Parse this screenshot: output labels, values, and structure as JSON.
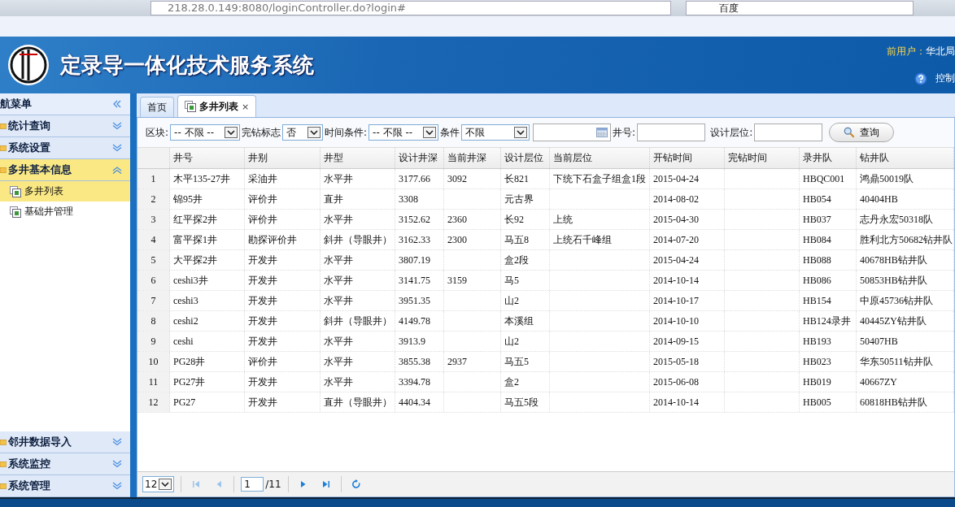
{
  "browser": {
    "url": "218.28.0.149:8080/loginController.do?login#",
    "search": "百度"
  },
  "header": {
    "title": "定录导一体化技术服务系统",
    "user_label": "前用户：",
    "user": "华北局",
    "control": "控制"
  },
  "nav": {
    "title": "航菜单",
    "sections": [
      {
        "label": "统计查询",
        "expanded": false
      },
      {
        "label": "系统设置",
        "expanded": false
      },
      {
        "label": "多井基本信息",
        "expanded": true,
        "children": [
          {
            "label": "多井列表",
            "selected": true
          },
          {
            "label": "基础井管理",
            "selected": false
          }
        ]
      },
      {
        "label": "邻井数据导入",
        "expanded": false
      },
      {
        "label": "系统监控",
        "expanded": false
      },
      {
        "label": "系统管理",
        "expanded": false
      }
    ]
  },
  "tabs": [
    {
      "label": "首页",
      "selected": false
    },
    {
      "label": "多井列表",
      "selected": true,
      "close": "×"
    }
  ],
  "filters": [
    {
      "kind": "select",
      "label": "区块:",
      "value": "-- 不限 --"
    },
    {
      "kind": "select",
      "label": "完钻标志",
      "value": "否"
    },
    {
      "kind": "select",
      "label": "时间条件:",
      "value": "-- 不限 --"
    },
    {
      "kind": "select",
      "label": "条件",
      "value": "不限"
    },
    {
      "kind": "date"
    },
    {
      "kind": "input",
      "label": "井号:"
    },
    {
      "kind": "input",
      "label": "设计层位:"
    },
    {
      "kind": "button",
      "label": "查询"
    }
  ],
  "table": {
    "columns": [
      "井号",
      "井别",
      "井型",
      "设计井深",
      "当前井深",
      "设计层位",
      "当前层位",
      "开钻时间",
      "完钻时间",
      "录井队",
      "钻井队"
    ],
    "rows": [
      {
        "n": "1",
        "cells": [
          "木平135-27井",
          "采油井",
          "水平井",
          "3177.66",
          "3092",
          "长821",
          "下统下石盒子组盒1段",
          "2015-04-24",
          "",
          "HBQC001",
          "鸿鼎50019队"
        ]
      },
      {
        "n": "2",
        "cells": [
          "锦95井",
          "评价井",
          "直井",
          "3308",
          "",
          "元古界",
          "",
          "2014-08-02",
          "",
          "HB054",
          "40404HB"
        ]
      },
      {
        "n": "3",
        "cells": [
          "红平探2井",
          "评价井",
          "水平井",
          "3152.62",
          "2360",
          "长92",
          "上统",
          "2015-04-30",
          "",
          "HB037",
          "志丹永宏50318队"
        ]
      },
      {
        "n": "4",
        "cells": [
          "富平探1井",
          "勘探评价井",
          "斜井（导眼井）",
          "3162.33",
          "2300",
          "马五8",
          "上统石千峰组",
          "2014-07-20",
          "",
          "HB084",
          "胜利北方50682钻井队"
        ]
      },
      {
        "n": "5",
        "cells": [
          "大平探2井",
          "开发井",
          "水平井",
          "3807.19",
          "",
          "盒2段",
          "",
          "2015-04-24",
          "",
          "HB088",
          "40678HB钻井队"
        ]
      },
      {
        "n": "6",
        "cells": [
          "ceshi3井",
          "开发井",
          "水平井",
          "3141.75",
          "3159",
          "马5",
          "",
          "2014-10-14",
          "",
          "HB086",
          "50853HB钻井队"
        ]
      },
      {
        "n": "7",
        "cells": [
          "ceshi3",
          "开发井",
          "水平井",
          "3951.35",
          "",
          "山2",
          "",
          "2014-10-17",
          "",
          "HB154",
          "中原45736钻井队"
        ]
      },
      {
        "n": "8",
        "cells": [
          "ceshi2",
          "开发井",
          "斜井（导眼井）",
          "4149.78",
          "",
          "本溪组",
          "",
          "2014-10-10",
          "",
          "HB124录井",
          "40445ZY钻井队"
        ]
      },
      {
        "n": "9",
        "cells": [
          "ceshi",
          "开发井",
          "水平井",
          "3913.9",
          "",
          "山2",
          "",
          "2014-09-15",
          "",
          "HB193",
          "50407HB"
        ]
      },
      {
        "n": "10",
        "cells": [
          "PG28井",
          "评价井",
          "水平井",
          "3855.38",
          "2937",
          "马五5",
          "",
          "2015-05-18",
          "",
          "HB023",
          "华东50511钻井队"
        ]
      },
      {
        "n": "11",
        "cells": [
          "PG27井",
          "开发井",
          "水平井",
          "3394.78",
          "",
          "盒2",
          "",
          "2015-06-08",
          "",
          "HB019",
          "40667ZY"
        ]
      },
      {
        "n": "12",
        "cells": [
          "PG27",
          "开发井",
          "直井（导眼井）",
          "4404.34",
          "",
          "马五5段",
          "",
          "2014-10-14",
          "",
          "HB005",
          "60818HB钻井队"
        ]
      }
    ]
  },
  "pager": {
    "page_size": "12",
    "page": "1",
    "total": "/11"
  }
}
